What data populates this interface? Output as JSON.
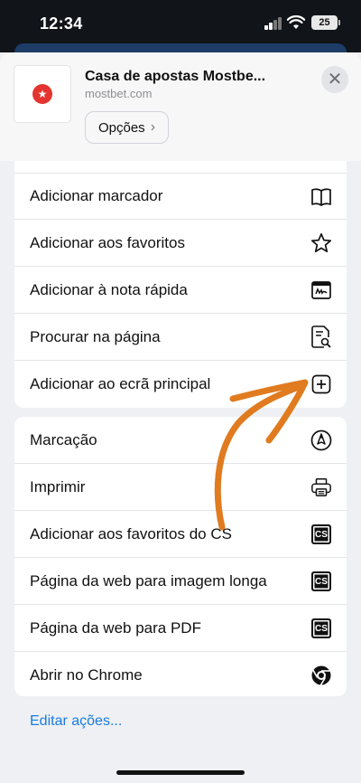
{
  "status_bar": {
    "time": "12:34",
    "battery": "25"
  },
  "share_header": {
    "title": "Casa de apostas Mostbe...",
    "url": "mostbet.com",
    "options_label": "Opções",
    "options_chevron": "›",
    "close_glyph": "✕",
    "logo_glyph": "★"
  },
  "group1": [
    {
      "label": "Adicionar marcador",
      "icon": "book-icon"
    },
    {
      "label": "Adicionar aos favoritos",
      "icon": "star-icon"
    },
    {
      "label": "Adicionar à nota rápida",
      "icon": "quick-note-icon"
    },
    {
      "label": "Procurar na página",
      "icon": "find-on-page-icon"
    },
    {
      "label": "Adicionar ao ecrã principal",
      "icon": "plus-square-icon"
    }
  ],
  "group2": [
    {
      "label": "Marcação",
      "icon": "markup-pen-icon"
    },
    {
      "label": "Imprimir",
      "icon": "printer-icon"
    },
    {
      "label": "Adicionar aos favoritos do CS",
      "icon": "cs-icon",
      "badge": "CS"
    },
    {
      "label": "Página da web para imagem longa",
      "icon": "cs-icon",
      "badge": "CS"
    },
    {
      "label": "Página da web para PDF",
      "icon": "cs-icon",
      "badge": "CS"
    },
    {
      "label": "Abrir no Chrome",
      "icon": "chrome-icon"
    }
  ],
  "edit_actions": "Editar ações...",
  "colors": {
    "accent": "#1a7ae0",
    "arrow": "#e07b1f",
    "brand_logo": "#e5342f"
  }
}
